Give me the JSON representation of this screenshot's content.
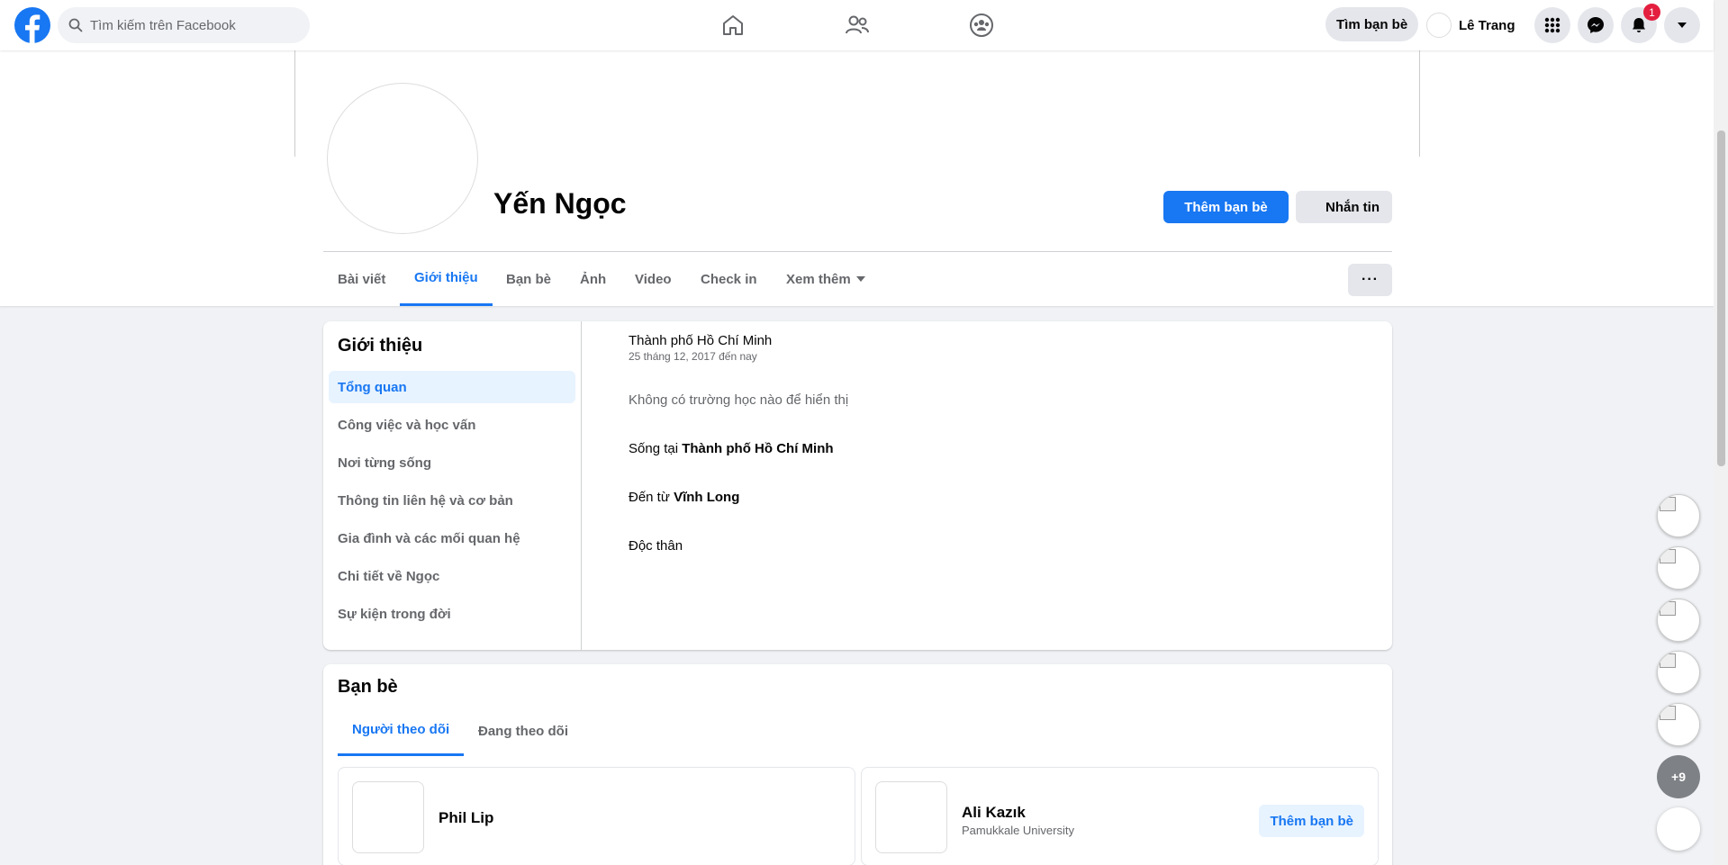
{
  "topbar": {
    "search_placeholder": "Tìm kiếm trên Facebook",
    "find_friends_label": "Tìm bạn bè",
    "user_name": "Lê Trang",
    "notification_count": "1"
  },
  "profile": {
    "name": "Yến Ngọc",
    "add_friend_label": "Thêm bạn bè",
    "message_label": "Nhắn tin",
    "more_label": "···"
  },
  "tabs": [
    {
      "label": "Bài viết"
    },
    {
      "label": "Giới thiệu"
    },
    {
      "label": "Bạn bè"
    },
    {
      "label": "Ảnh"
    },
    {
      "label": "Video"
    },
    {
      "label": "Check in"
    },
    {
      "label": "Xem thêm"
    }
  ],
  "about": {
    "title": "Giới thiệu",
    "menu": [
      {
        "label": "Tổng quan"
      },
      {
        "label": "Công việc và học vấn"
      },
      {
        "label": "Nơi từng sống"
      },
      {
        "label": "Thông tin liên hệ và cơ bản"
      },
      {
        "label": "Gia đình và các mối quan hệ"
      },
      {
        "label": "Chi tiết về Ngọc"
      },
      {
        "label": "Sự kiện trong đời"
      }
    ],
    "work_place": "Thành phố Hồ Chí Minh",
    "work_dates": "25 tháng 12, 2017 đến nay",
    "no_school": "Không có trường học nào để hiển thị",
    "lives_prefix": "Sống tại ",
    "lives_city": "Thành phố Hồ Chí Minh",
    "from_prefix": "Đến từ ",
    "from_city": "Vĩnh Long",
    "relationship": "Độc thân"
  },
  "friends": {
    "title": "Bạn bè",
    "tabs": [
      {
        "label": "Người theo dõi"
      },
      {
        "label": "Đang theo dõi"
      }
    ],
    "items": [
      {
        "name": "Phil Lip",
        "subtitle": ""
      },
      {
        "name": "Ali Kazık",
        "subtitle": "Pamukkale University",
        "button": "Thêm bạn bè"
      }
    ]
  },
  "rail": {
    "more_count": "+9"
  },
  "colors": {
    "brand": "#1877f2",
    "badge": "#e41e3f"
  }
}
